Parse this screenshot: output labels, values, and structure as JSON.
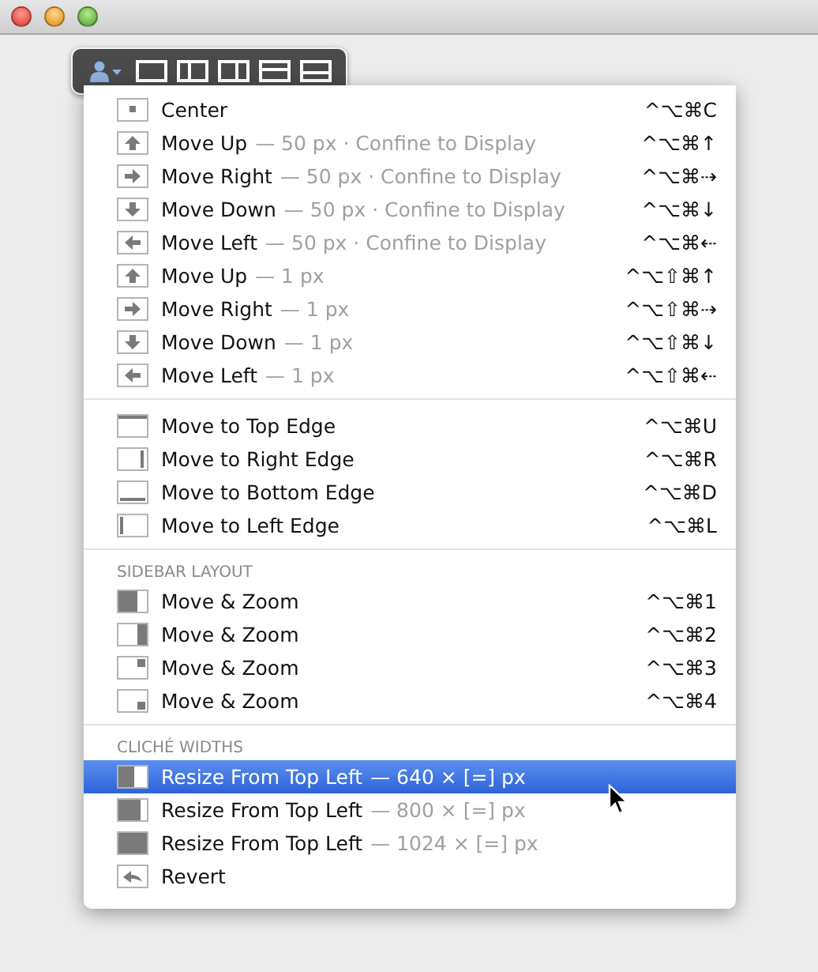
{
  "sections": [
    {
      "items": [
        {
          "kind": "center",
          "label": "Center",
          "shortcut": "^⌥⌘C",
          "selected": false
        },
        {
          "kind": "up",
          "label": "Move Up",
          "detail": "— 50 px · Confine to Display",
          "shortcut": "^⌥⌘↑",
          "selected": false
        },
        {
          "kind": "right",
          "label": "Move Right",
          "detail": "— 50 px · Confine to Display",
          "shortcut": "^⌥⌘⇢",
          "selected": false
        },
        {
          "kind": "down",
          "label": "Move Down",
          "detail": "— 50 px · Confine to Display",
          "shortcut": "^⌥⌘↓",
          "selected": false
        },
        {
          "kind": "left",
          "label": "Move Left",
          "detail": "— 50 px · Confine to Display",
          "shortcut": "^⌥⌘⇠",
          "selected": false
        },
        {
          "kind": "up",
          "label": "Move Up",
          "detail": "— 1 px",
          "shortcut": "^⌥⇧⌘↑",
          "selected": false
        },
        {
          "kind": "right",
          "label": "Move Right",
          "detail": "— 1 px",
          "shortcut": "^⌥⇧⌘⇢",
          "selected": false
        },
        {
          "kind": "down",
          "label": "Move Down",
          "detail": "— 1 px",
          "shortcut": "^⌥⇧⌘↓",
          "selected": false
        },
        {
          "kind": "left",
          "label": "Move Left",
          "detail": "— 1 px",
          "shortcut": "^⌥⇧⌘⇠",
          "selected": false
        }
      ]
    },
    {
      "items": [
        {
          "kind": "topedge",
          "label": "Move to Top Edge",
          "shortcut": "^⌥⌘U",
          "selected": false
        },
        {
          "kind": "rightedge",
          "label": "Move to Right Edge",
          "shortcut": "^⌥⌘R",
          "selected": false
        },
        {
          "kind": "bottomedge",
          "label": "Move to Bottom Edge",
          "shortcut": "^⌥⌘D",
          "selected": false
        },
        {
          "kind": "leftedge",
          "label": "Move to Left Edge",
          "shortcut": "^⌥⌘L",
          "selected": false
        }
      ]
    },
    {
      "header": "SIDEBAR LAYOUT",
      "items": [
        {
          "kind": "lefthalf",
          "label": "Move & Zoom",
          "shortcut": "^⌥⌘1",
          "selected": false
        },
        {
          "kind": "righthalf",
          "label": "Move & Zoom",
          "shortcut": "^⌥⌘2",
          "selected": false
        },
        {
          "kind": "topright",
          "label": "Move & Zoom",
          "shortcut": "^⌥⌘3",
          "selected": false
        },
        {
          "kind": "bottomright",
          "label": "Move & Zoom",
          "shortcut": "^⌥⌘4",
          "selected": false
        }
      ]
    },
    {
      "header": "CLICHÉ WIDTHS",
      "items": [
        {
          "kind": "small",
          "label": "Resize From Top Left",
          "detail": "— 640 × [=] px",
          "selected": true
        },
        {
          "kind": "medium",
          "label": "Resize From Top Left",
          "detail": "— 800 × [=] px",
          "selected": false
        },
        {
          "kind": "large",
          "label": "Resize From Top Left",
          "detail": "— 1024 × [=] px",
          "selected": false
        },
        {
          "kind": "revert",
          "label": "Revert",
          "selected": false
        }
      ]
    }
  ]
}
